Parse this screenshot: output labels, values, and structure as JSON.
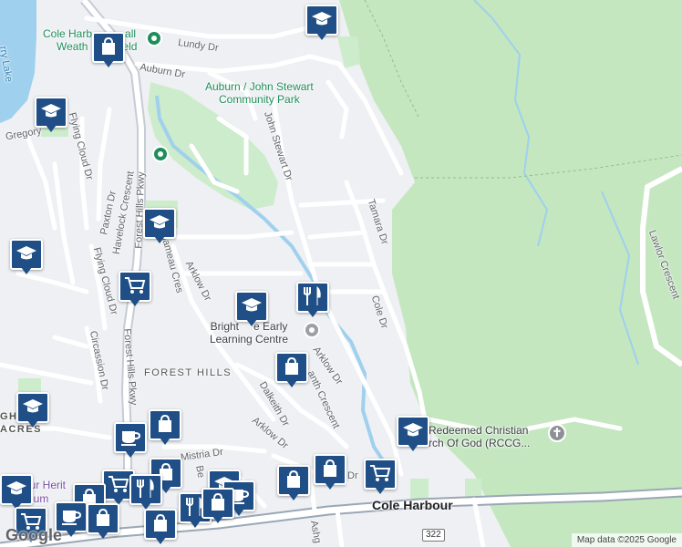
{
  "map": {
    "attribution": "Map data ©2025 Google",
    "logo": "Google",
    "route_shield": "322",
    "colors": {
      "land": "#eef0f3",
      "park": "#cdeccb",
      "woods": "#c4e7c0",
      "water": "#9fd0ee",
      "road": "#ffffff",
      "highway": "#9aa7b5",
      "poi_pin": "#1f4f86"
    },
    "labels": {
      "cole_harbour_weather": "Cole Harbour All Weather Field",
      "cole_harbour_weather_l1": "Cole Harb",
      "cole_harbour_weather_l1b": "all",
      "cole_harbour_weather_l2": "Weath",
      "cole_harbour_weather_l2b": "eld",
      "lundy_dr": "Lundy Dr",
      "auburn_dr": "Auburn Dr",
      "park_line1": "Auburn / John Stewart",
      "park_line2": "Community Park",
      "gregory": "Gregory",
      "lake": "rry Lake",
      "flying_cloud_dr_top": "Flying Cloud Dr",
      "paxton_dr": "Paxton Dr",
      "havelock_crescent": "Havelock Crescent",
      "forest_hills_pkwy_top": "Forest Hills Pkwy",
      "john_stewart_dr": "John Stewart Dr",
      "tamara_dr": "Tamara Dr",
      "chameau_cres": "Chameau Cres",
      "arklow_dr_top": "Arklow Dr",
      "flying_cloud_dr_bottom": "Flying Cloud Dr",
      "circassion_dr": "Circassion Dr",
      "forest_hills_pkwy_bottom": "Forest Hills Pkwy",
      "learning_line1": "Bright Hope Early",
      "learning_line1_partial": "Bright",
      "learning_line1_end": "e Early",
      "learning_line2": "Learning Centre",
      "cole_dr": "Cole Dr",
      "arklow_dr_mid": "Arklow Dr",
      "forest_hills": "FOREST HILLS",
      "anth_crescent": "anth Crescent",
      "dalkeith_dr": "Dalkeith Dr",
      "arklow_dr_bottom": "Arklow Dr",
      "redeemed_line1": "Redeemed Christian",
      "redeemed_line2": "rch Of God (RCCG...",
      "lawlor_crescent": "Lawlor Crescent",
      "cole_harbour": "Cole Harbour",
      "ashg": "Ashg",
      "dr_small": "Dr",
      "mistria_dr": "Mistria Dr",
      "bel": "Be",
      "heritage_line1": "our Herit",
      "heritage_line2": "eum",
      "acres": "ACRES",
      "gh": "GH"
    },
    "pois": [
      {
        "icon": "school-icon"
      },
      {
        "icon": "shopping-bag-icon"
      },
      {
        "icon": "school-icon"
      },
      {
        "icon": "school-icon"
      },
      {
        "icon": "school-icon"
      },
      {
        "icon": "shopping-cart-icon"
      },
      {
        "icon": "school-icon"
      },
      {
        "icon": "restaurant-icon"
      },
      {
        "icon": "shopping-bag-icon"
      },
      {
        "icon": "school-icon"
      },
      {
        "icon": "school-icon"
      },
      {
        "icon": "shopping-bag-icon"
      },
      {
        "icon": "cafe-icon"
      },
      {
        "icon": "shopping-bag-icon"
      },
      {
        "icon": "shopping-cart-icon"
      },
      {
        "icon": "shopping-bag-icon"
      },
      {
        "icon": "shopping-cart-icon"
      }
    ]
  }
}
